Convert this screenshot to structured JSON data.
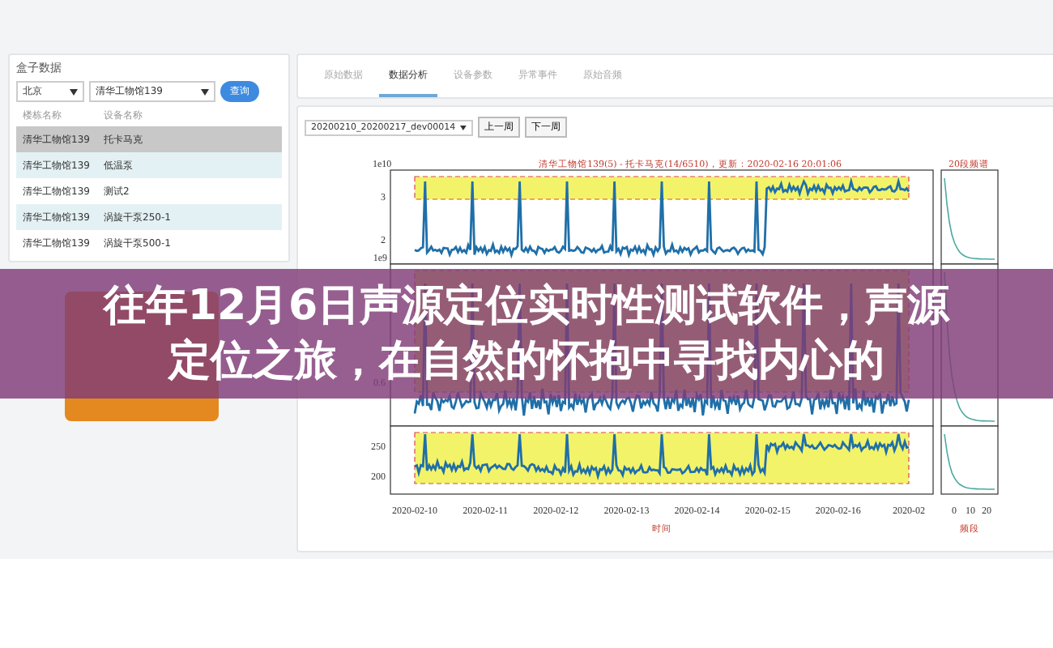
{
  "left_panel": {
    "title": "盒子数据",
    "city_select": "北京",
    "building_select": "清华工物馆139",
    "query_button": "查询",
    "columns": [
      "楼栋名称",
      "设备名称"
    ],
    "rows": [
      {
        "building": "清华工物馆139",
        "device": "托卡马克",
        "selected": true
      },
      {
        "building": "清华工物馆139",
        "device": "低温泵",
        "selected": false
      },
      {
        "building": "清华工物馆139",
        "device": "测试2",
        "selected": false
      },
      {
        "building": "清华工物馆139",
        "device": "涡旋干泵250-1",
        "selected": false
      },
      {
        "building": "清华工物馆139",
        "device": "涡旋干泵500-1",
        "selected": false
      }
    ]
  },
  "tabs": [
    {
      "label": "原始数据",
      "selected": false
    },
    {
      "label": "数据分析",
      "selected": true
    },
    {
      "label": "设备参数",
      "selected": false
    },
    {
      "label": "异常事件",
      "selected": false
    },
    {
      "label": "原始音频",
      "selected": false
    }
  ],
  "toolbar": {
    "dataset_select": "20200210_20200217_dev00014",
    "prev_button": "上一周",
    "next_button": "下一周"
  },
  "chart": {
    "title": "清华工物馆139(5) - 托卡马克(14/6510)，更新：2020-02-16 20:01:06",
    "side_title": "20段频谱",
    "y_scale": "1e10",
    "panels": [
      {
        "y_ticks": [
          "3",
          "2"
        ],
        "bottom_label": "1e9"
      },
      {
        "y_ticks": [
          "0.6"
        ]
      },
      {
        "y_ticks": [
          "250",
          "200"
        ]
      }
    ],
    "x_ticks": [
      "2020-02-10",
      "2020-02-11",
      "2020-02-12",
      "2020-02-13",
      "2020-02-14",
      "2020-02-15",
      "2020-02-16",
      "2020-02"
    ],
    "xlabel": "时间",
    "side_xticks": [
      "0",
      "10",
      "20"
    ],
    "side_xlabel": "频段"
  },
  "banner": {
    "text": "往年12月6日声源定位实时性测试软件，声源定位之旅，在自然的怀抱中寻找内心的"
  }
}
